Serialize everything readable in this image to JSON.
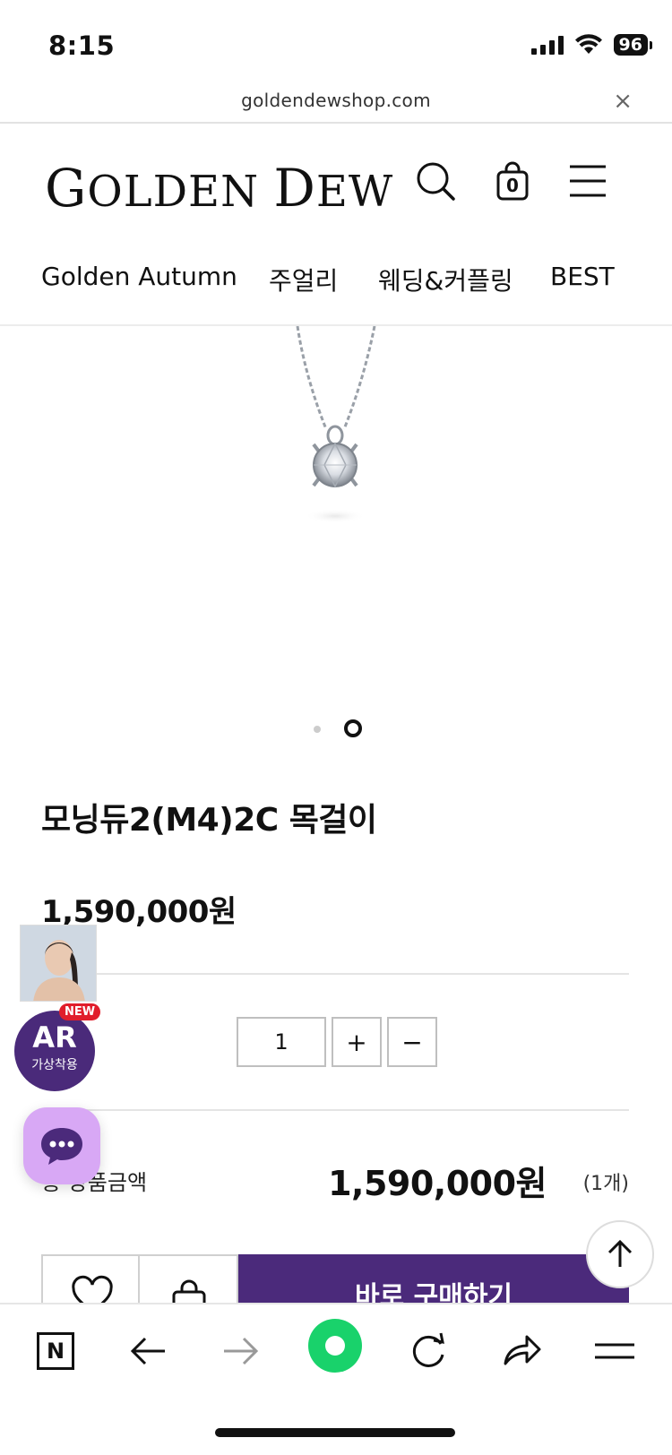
{
  "status": {
    "time": "8:15",
    "battery": "96"
  },
  "url_bar": {
    "url": "goldendewshop.com",
    "close_glyph": "×"
  },
  "header": {
    "logo_first": "G",
    "logo_rest": "OLDEN ",
    "logo_d": "D",
    "logo_ew": "EW",
    "cart_count": "0",
    "icons": [
      "search-icon",
      "shopping-bag-icon",
      "menu-icon"
    ]
  },
  "categories": [
    "Golden Autumn",
    "주얼리",
    "웨딩&커플링",
    "BEST"
  ],
  "product": {
    "title": "모닝듀2(M4)2C 목걸이",
    "price": "1,590,000원",
    "quantity": "1",
    "plus": "+",
    "minus": "−",
    "total_label": "총 상품금액",
    "total_price": "1,590,000원",
    "total_count": "(1개)",
    "buy_label": "바로 구매하기"
  },
  "floating": {
    "ar_title": "AR",
    "ar_sub": "가상착용",
    "ar_new": "NEW"
  },
  "browser_toolbar": {
    "n_label": "N",
    "icons": [
      "naver-n-icon",
      "back-arrow-icon",
      "forward-arrow-icon",
      "green-circle-icon",
      "refresh-icon",
      "share-icon",
      "menu-lines-icon"
    ]
  },
  "colors": {
    "brand_purple": "#4b2a7b",
    "chat_lilac": "#d8a8f5",
    "new_red": "#e11d2b",
    "green": "#19d26b"
  }
}
